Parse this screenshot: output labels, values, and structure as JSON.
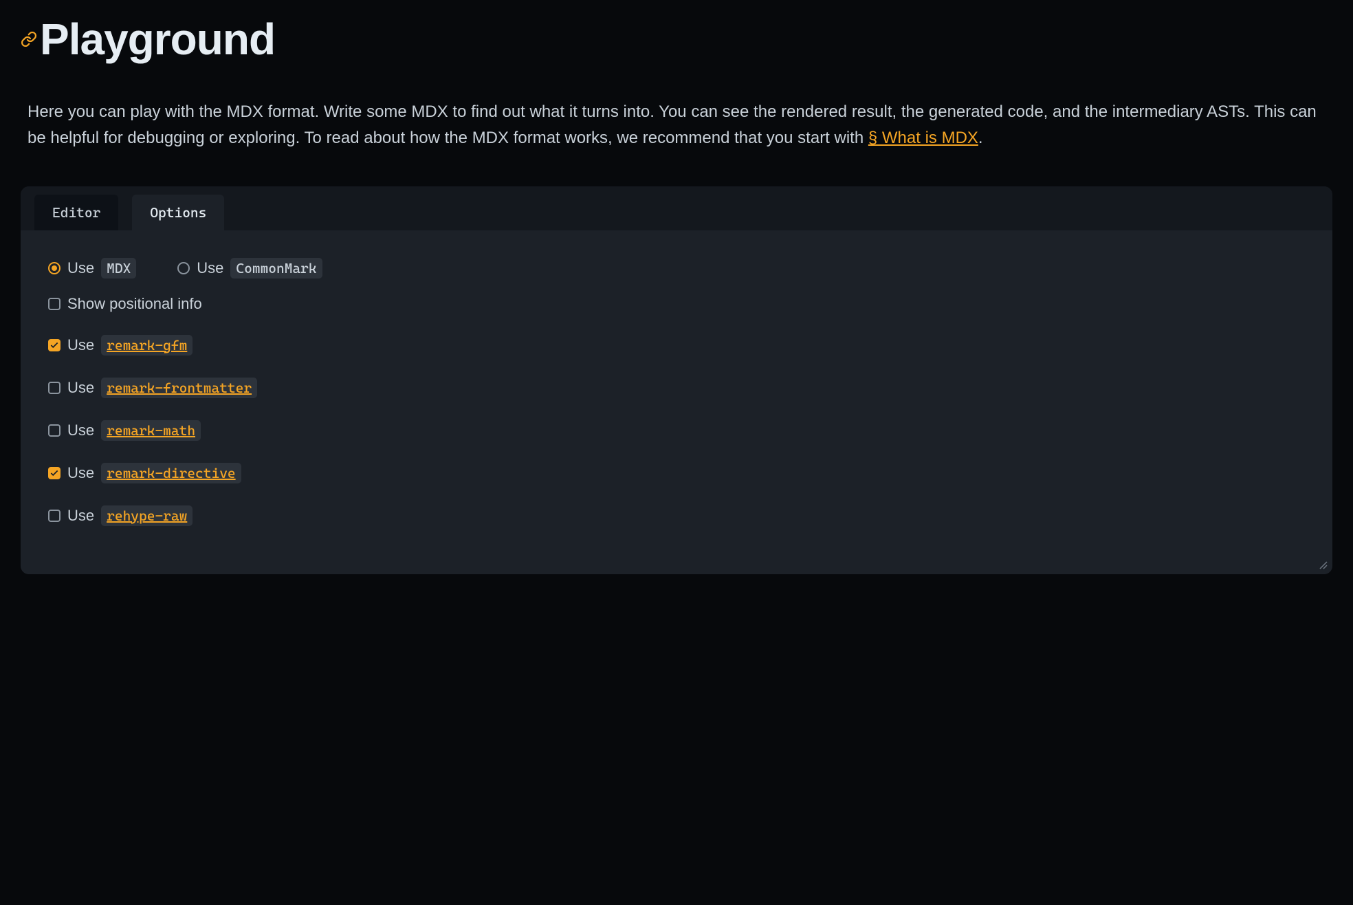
{
  "header": {
    "title": "Playground"
  },
  "intro": {
    "text_before_link": "Here you can play with the MDX format. Write some MDX to find out what it turns into. You can see the rendered result, the generated code, and the intermediary ASTs. This can be helpful for debugging or exploring. To read about how the MDX format works, we recommend that you start with ",
    "link_text": "§ What is MDX",
    "text_after_link": "."
  },
  "tabs": {
    "editor": "Editor",
    "options": "Options"
  },
  "options": {
    "format_use_prefix": "Use ",
    "format_mdx_label": "MDX",
    "format_commonmark_label": "CommonMark",
    "show_positional_label": "Show positional info",
    "plugins": [
      {
        "label": "remark-gfm",
        "checked": true
      },
      {
        "label": "remark-frontmatter",
        "checked": false
      },
      {
        "label": "remark-math",
        "checked": false
      },
      {
        "label": "remark-directive",
        "checked": true
      },
      {
        "label": "rehype-raw",
        "checked": false
      }
    ]
  }
}
